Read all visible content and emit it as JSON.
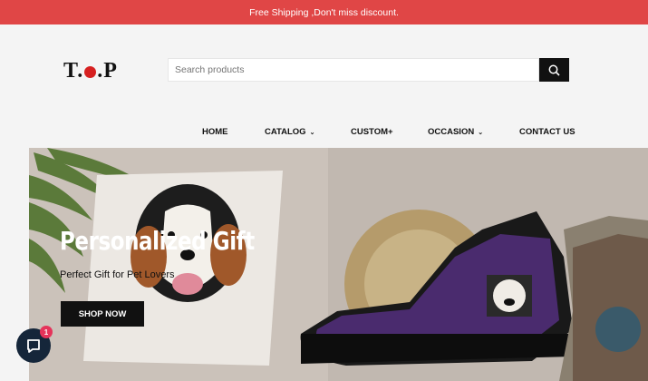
{
  "announcement": {
    "text": "Free Shipping ,Don't miss discount."
  },
  "logo": {
    "text_left": "T.",
    "text_right": ".P",
    "dot_color": "#d62020"
  },
  "search": {
    "placeholder": "Search products",
    "value": "",
    "icon": "search-icon"
  },
  "nav": {
    "items": [
      {
        "label": "HOME",
        "has_dropdown": false
      },
      {
        "label": "CATALOG",
        "has_dropdown": true
      },
      {
        "label": "CUSTOM+",
        "has_dropdown": false
      },
      {
        "label": "OCCASION",
        "has_dropdown": true
      },
      {
        "label": "CONTACT US",
        "has_dropdown": false
      }
    ],
    "dropdown_glyph": "⌄"
  },
  "hero": {
    "title": "Personalized Gift",
    "subtitle": "Perfect Gift for Pet Lovers",
    "cta_label": "SHOP NOW"
  },
  "chat": {
    "unread_count": "1",
    "icon": "chat-bubble-icon"
  },
  "colors": {
    "announcement_bg": "#e04646",
    "accent_dark": "#111111",
    "badge": "#e5335a"
  }
}
